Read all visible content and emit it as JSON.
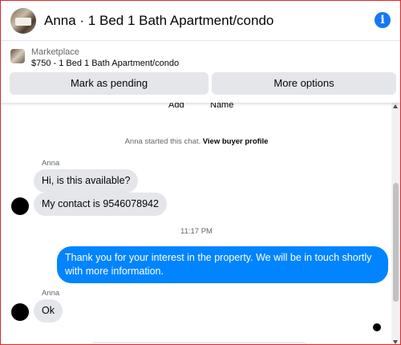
{
  "header": {
    "title": "Anna · 1 Bed 1 Bath Apartment/condo",
    "info_icon": "info-icon"
  },
  "listing": {
    "source": "Marketplace",
    "description": "$750 - 1 Bed 1 Bath Apartment/condo",
    "pending_label": "Mark as pending",
    "options_label": "More options"
  },
  "chat": {
    "column_labels": {
      "add": "Add",
      "name": "Name"
    },
    "system_message": "Anna started this chat.",
    "system_link": "View buyer profile",
    "groups": [
      {
        "sender": "Anna",
        "messages": [
          "Hi, is this available?",
          "My contact is 9546078942"
        ]
      },
      {
        "timestamp": "11:17 PM",
        "outgoing": "Thank you for your interest in the property. We will be in touch shortly with more information."
      },
      {
        "sender": "Anna",
        "messages": [
          "Ok"
        ]
      }
    ]
  },
  "colors": {
    "accent": "#1877f2",
    "outgoing_bubble": "#0084ff",
    "incoming_bubble": "#e4e6eb",
    "frame_border": "#e3262b"
  }
}
